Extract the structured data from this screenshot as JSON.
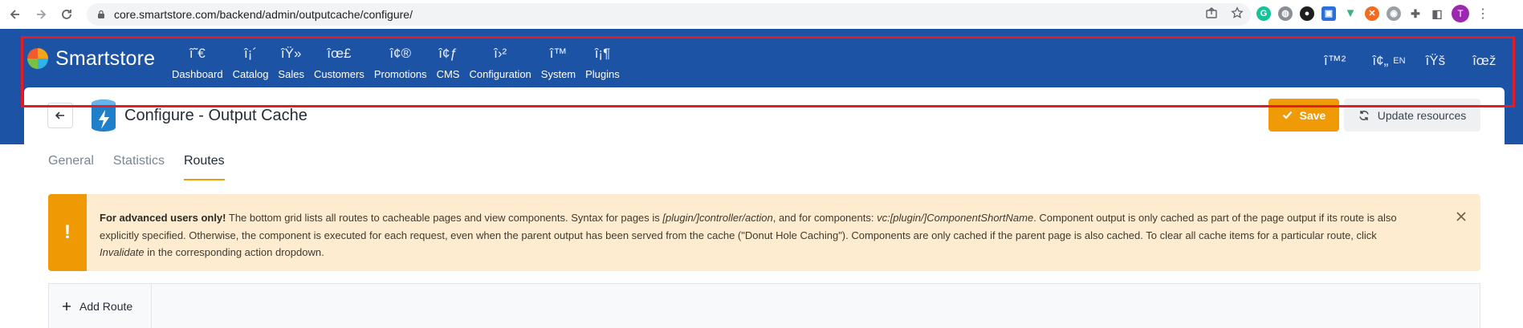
{
  "browser": {
    "url": "core.smartstore.com/backend/admin/outputcache/configure/",
    "avatar_letter": "T",
    "icons": [
      "back-icon",
      "forward-icon",
      "reload-icon",
      "lock-icon",
      "share-icon",
      "star-icon",
      "grammarly-icon",
      "globe-icon",
      "extension-dark-icon",
      "extension-blue-icon",
      "vue-icon",
      "extension-orange-icon",
      "extension-gray-icon",
      "puzzle-icon",
      "sidepanel-icon",
      "kebab-menu-icon"
    ]
  },
  "header": {
    "brand": "Smartstore",
    "menu": [
      {
        "glyph": "î˜€",
        "label": "Dashboard"
      },
      {
        "glyph": "î¡´",
        "label": "Catalog"
      },
      {
        "glyph": "îŸ»",
        "label": "Sales"
      },
      {
        "glyph": "îœ£",
        "label": "Customers"
      },
      {
        "glyph": "î¢®",
        "label": "Promotions"
      },
      {
        "glyph": "î¢ƒ",
        "label": "CMS"
      },
      {
        "glyph": "î›²",
        "label": "Configuration"
      },
      {
        "glyph": "î™",
        "label": "System"
      },
      {
        "glyph": "î¡¶",
        "label": "Plugins"
      }
    ],
    "right": {
      "glyph_1": "î™²",
      "glyph_2": "î¢„",
      "lang": "EN",
      "glyph_3": "îŸš",
      "glyph_4": "îœž"
    }
  },
  "page": {
    "title": "Configure - Output Cache",
    "save_label": "Save",
    "update_label": "Update resources",
    "tabs": [
      "General",
      "Statistics",
      "Routes"
    ],
    "active_tab": "Routes"
  },
  "alert": {
    "strong": "For advanced users only!",
    "t1": " The bottom grid lists all routes to cacheable pages and view components. Syntax for pages is ",
    "em1": "[plugin/]controller/action",
    "t2": ", and for components: ",
    "em2": "vc:[plugin/]ComponentShortName",
    "t3": ". Component output is only cached as part of the page output if its route is also explicitly specified. Otherwise, the component is executed for each request, even when the parent output has been served from the cache (\"Donut Hole Caching\"). Components are only cached if the parent page is also cached. To clear all cache items for a particular route, click ",
    "em3": "Invalidate",
    "t4": " in the corresponding action dropdown.",
    "icon": "!"
  },
  "grid": {
    "add_route_label": "Add Route"
  },
  "colors": {
    "header_blue": "#1c53a5",
    "accent_orange": "#f09a06",
    "highlight_red": "#e21d2a",
    "alert_bg": "#fdecd0"
  }
}
